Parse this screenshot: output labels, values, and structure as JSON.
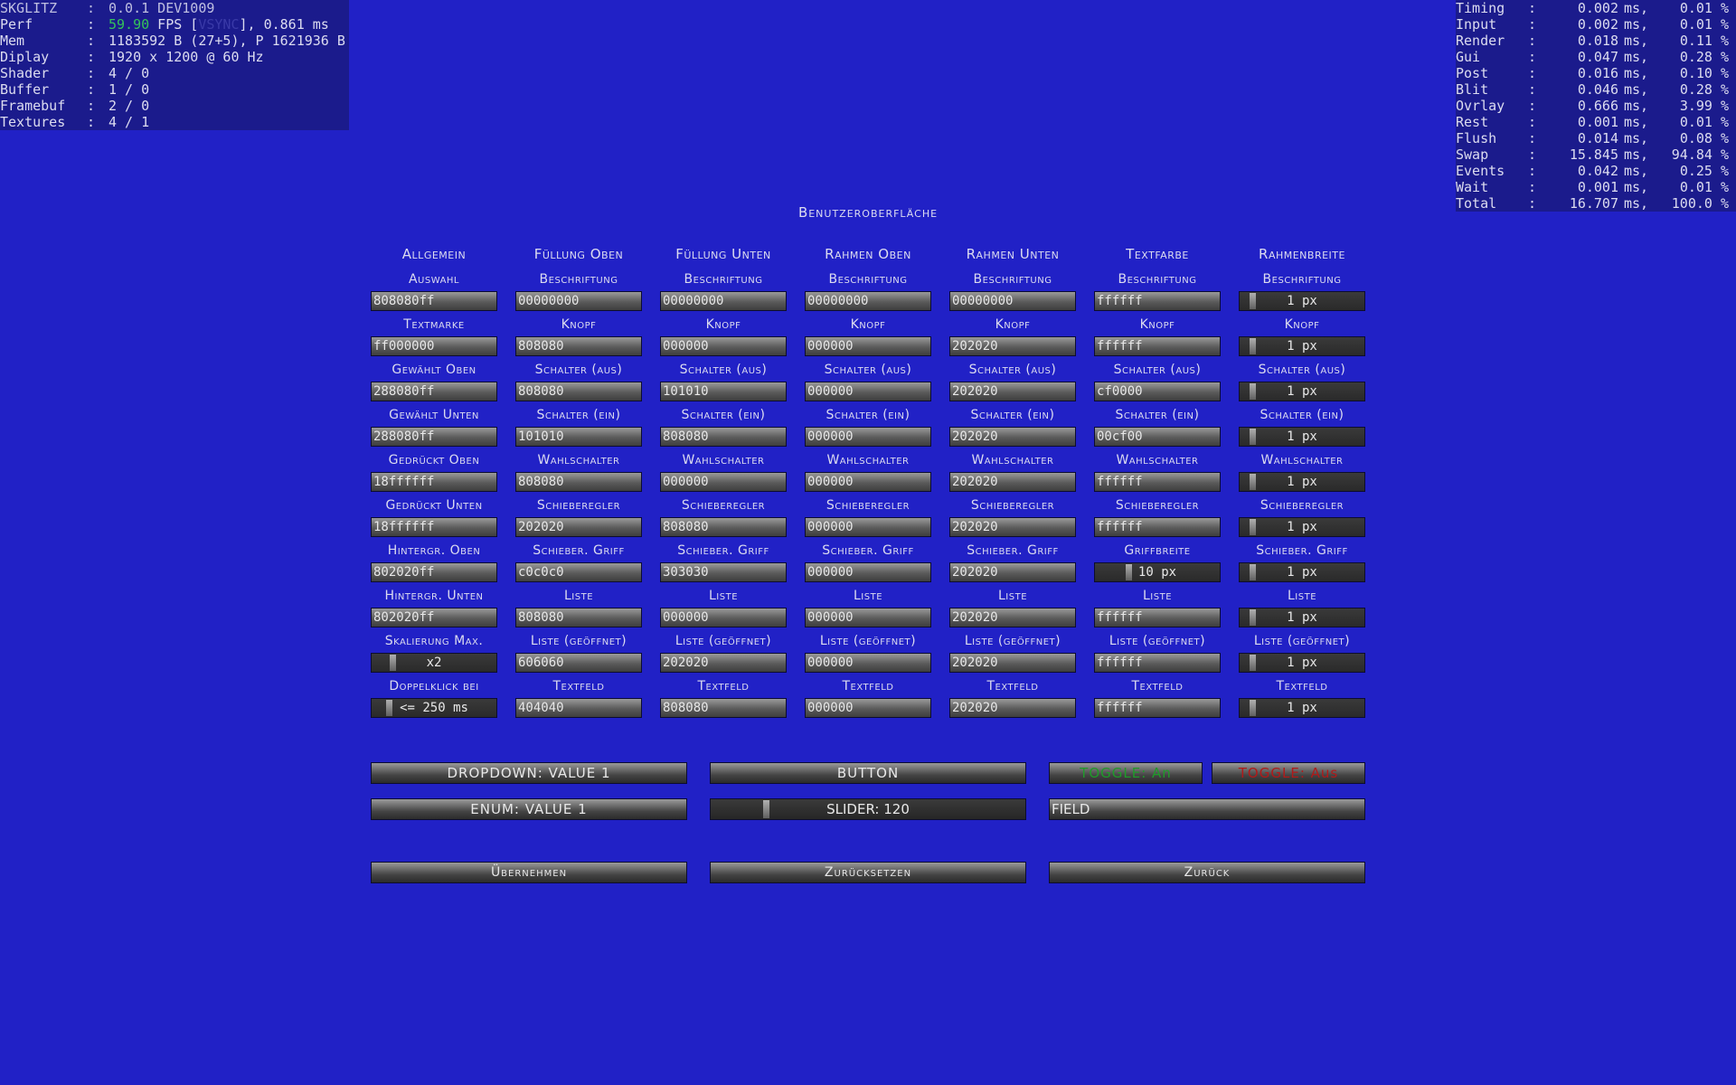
{
  "stats_left": [
    {
      "k": "SKGLITZ",
      "v": "0.0.1 DEV1009",
      "header": true
    },
    {
      "k": "Perf",
      "fps": "59.90",
      "fps_tail": " FPS [",
      "vsync": "VSYNC",
      "tail": "], 0.861 ms"
    },
    {
      "k": "Mem",
      "v": "1183592 B (27+5), P 1621936 B"
    },
    {
      "k": "Diplay",
      "v": "1920 x 1200 @ 60 Hz"
    },
    {
      "k": "Shader",
      "v": "4 / 0"
    },
    {
      "k": "Buffer",
      "v": "1 / 0"
    },
    {
      "k": "Framebuf",
      "v": "2 / 0"
    },
    {
      "k": "Textures",
      "v": "4 / 1"
    }
  ],
  "stats_right": [
    {
      "k": "Timing",
      "v1": "0.002",
      "u": "ms,",
      "v2": "0.01 %"
    },
    {
      "k": "Input",
      "v1": "0.002",
      "u": "ms,",
      "v2": "0.01 %"
    },
    {
      "k": "Render",
      "v1": "0.018",
      "u": "ms,",
      "v2": "0.11 %"
    },
    {
      "k": "Gui",
      "v1": "0.047",
      "u": "ms,",
      "v2": "0.28 %"
    },
    {
      "k": "Post",
      "v1": "0.016",
      "u": "ms,",
      "v2": "0.10 %"
    },
    {
      "k": "Blit",
      "v1": "0.046",
      "u": "ms,",
      "v2": "0.28 %"
    },
    {
      "k": "Ovrlay",
      "v1": "0.666",
      "u": "ms,",
      "v2": "3.99 %"
    },
    {
      "k": "Rest",
      "v1": "0.001",
      "u": "ms,",
      "v2": "0.01 %"
    },
    {
      "k": "Flush",
      "v1": "0.014",
      "u": "ms,",
      "v2": "0.08 %"
    },
    {
      "k": "Swap",
      "v1": "15.845",
      "u": "ms,",
      "v2": "94.84 %"
    },
    {
      "k": "Events",
      "v1": "0.042",
      "u": "ms,",
      "v2": "0.25 %"
    },
    {
      "k": "Wait",
      "v1": "0.001",
      "u": "ms,",
      "v2": "0.01 %"
    },
    {
      "k": "Total",
      "v1": "16.707",
      "u": "ms,",
      "v2": "100.0 %"
    }
  ],
  "title": "Benutzeroberfläche",
  "columns": [
    {
      "header": "Allgemein",
      "cells": [
        {
          "label": "Auswahl",
          "value": "808080ff"
        },
        {
          "label": "Textmarke",
          "value": "ff000000"
        },
        {
          "label": "Gewählt Oben",
          "value": "288080ff"
        },
        {
          "label": "Gewählt Unten",
          "value": "288080ff"
        },
        {
          "label": "Gedrückt Oben",
          "value": "18ffffff"
        },
        {
          "label": "Gedrückt Unten",
          "value": "18ffffff"
        },
        {
          "label": "Hintergr. Oben",
          "value": "802020ff"
        },
        {
          "label": "Hintergr. Unten",
          "value": "802020ff"
        },
        {
          "label": "Skalierung Max.",
          "value": "x2",
          "slider": true,
          "level": 0.15
        },
        {
          "label": "Doppelklick bei",
          "value": "<= 250 ms",
          "slider": true,
          "level": 0.12
        }
      ]
    },
    {
      "header": "Füllung Oben",
      "cells": [
        {
          "label": "Beschriftung",
          "value": "00000000"
        },
        {
          "label": "Knopf",
          "value": "808080"
        },
        {
          "label": "Schalter (aus)",
          "value": "808080"
        },
        {
          "label": "Schalter (ein)",
          "value": "101010"
        },
        {
          "label": "Wahlschalter",
          "value": "808080"
        },
        {
          "label": "Schieberegler",
          "value": "202020"
        },
        {
          "label": "Schieber. Griff",
          "value": "c0c0c0"
        },
        {
          "label": "Liste",
          "value": "808080"
        },
        {
          "label": "Liste (geöffnet)",
          "value": "606060"
        },
        {
          "label": "Textfeld",
          "value": "404040"
        }
      ]
    },
    {
      "header": "Füllung Unten",
      "cells": [
        {
          "label": "Beschriftung",
          "value": "00000000"
        },
        {
          "label": "Knopf",
          "value": "000000"
        },
        {
          "label": "Schalter (aus)",
          "value": "101010"
        },
        {
          "label": "Schalter (ein)",
          "value": "808080"
        },
        {
          "label": "Wahlschalter",
          "value": "000000"
        },
        {
          "label": "Schieberegler",
          "value": "808080"
        },
        {
          "label": "Schieber. Griff",
          "value": "303030"
        },
        {
          "label": "Liste",
          "value": "000000"
        },
        {
          "label": "Liste (geöffnet)",
          "value": "202020"
        },
        {
          "label": "Textfeld",
          "value": "808080"
        }
      ]
    },
    {
      "header": "Rahmen Oben",
      "cells": [
        {
          "label": "Beschriftung",
          "value": "00000000"
        },
        {
          "label": "Knopf",
          "value": "000000"
        },
        {
          "label": "Schalter (aus)",
          "value": "000000"
        },
        {
          "label": "Schalter (ein)",
          "value": "000000"
        },
        {
          "label": "Wahlschalter",
          "value": "000000"
        },
        {
          "label": "Schieberegler",
          "value": "000000"
        },
        {
          "label": "Schieber. Griff",
          "value": "000000"
        },
        {
          "label": "Liste",
          "value": "000000"
        },
        {
          "label": "Liste (geöffnet)",
          "value": "000000"
        },
        {
          "label": "Textfeld",
          "value": "000000"
        }
      ]
    },
    {
      "header": "Rahmen Unten",
      "cells": [
        {
          "label": "Beschriftung",
          "value": "00000000"
        },
        {
          "label": "Knopf",
          "value": "202020"
        },
        {
          "label": "Schalter (aus)",
          "value": "202020"
        },
        {
          "label": "Schalter (ein)",
          "value": "202020"
        },
        {
          "label": "Wahlschalter",
          "value": "202020"
        },
        {
          "label": "Schieberegler",
          "value": "202020"
        },
        {
          "label": "Schieber. Griff",
          "value": "202020"
        },
        {
          "label": "Liste",
          "value": "202020"
        },
        {
          "label": "Liste (geöffnet)",
          "value": "202020"
        },
        {
          "label": "Textfeld",
          "value": "202020"
        }
      ]
    },
    {
      "header": "Textfarbe",
      "cells": [
        {
          "label": "Beschriftung",
          "value": "ffffff"
        },
        {
          "label": "Knopf",
          "value": "ffffff"
        },
        {
          "label": "Schalter (aus)",
          "value": "cf0000"
        },
        {
          "label": "Schalter (ein)",
          "value": "00cf00"
        },
        {
          "label": "Wahlschalter",
          "value": "ffffff"
        },
        {
          "label": "Schieberegler",
          "value": "ffffff"
        },
        {
          "label": "Griffbreite",
          "value": "10 px",
          "slider": true,
          "level": 0.26
        },
        {
          "label": "Liste",
          "value": "ffffff"
        },
        {
          "label": "Liste (geöffnet)",
          "value": "ffffff"
        },
        {
          "label": "Textfeld",
          "value": "ffffff"
        }
      ]
    },
    {
      "header": "Rahmenbreite",
      "cells": [
        {
          "label": "Beschriftung",
          "value": "1 px",
          "slider": true,
          "level": 0.08
        },
        {
          "label": "Knopf",
          "value": "1 px",
          "slider": true,
          "level": 0.08
        },
        {
          "label": "Schalter (aus)",
          "value": "1 px",
          "slider": true,
          "level": 0.08
        },
        {
          "label": "Schalter (ein)",
          "value": "1 px",
          "slider": true,
          "level": 0.08
        },
        {
          "label": "Wahlschalter",
          "value": "1 px",
          "slider": true,
          "level": 0.08
        },
        {
          "label": "Schieberegler",
          "value": "1 px",
          "slider": true,
          "level": 0.08
        },
        {
          "label": "Schieber. Griff",
          "value": "1 px",
          "slider": true,
          "level": 0.08
        },
        {
          "label": "Liste",
          "value": "1 px",
          "slider": true,
          "level": 0.08
        },
        {
          "label": "Liste (geöffnet)",
          "value": "1 px",
          "slider": true,
          "level": 0.08
        },
        {
          "label": "Textfeld",
          "value": "1 px",
          "slider": true,
          "level": 0.08
        }
      ]
    }
  ],
  "demo": {
    "dropdown": "DROPDOWN: VALUE 1",
    "button": "BUTTON",
    "toggle_on": "TOGGLE: An",
    "toggle_off": "TOGGLE: Aus",
    "enum": "ENUM: VALUE 1",
    "slider": "SLIDER: 120",
    "slider_level": 0.17,
    "field": "FIELD",
    "toggle_on_color": "#1f9a2a",
    "toggle_off_color": "#b01a1a"
  },
  "actions": {
    "apply": "Übernehmen",
    "reset": "Zurücksetzen",
    "back": "Zurück"
  }
}
